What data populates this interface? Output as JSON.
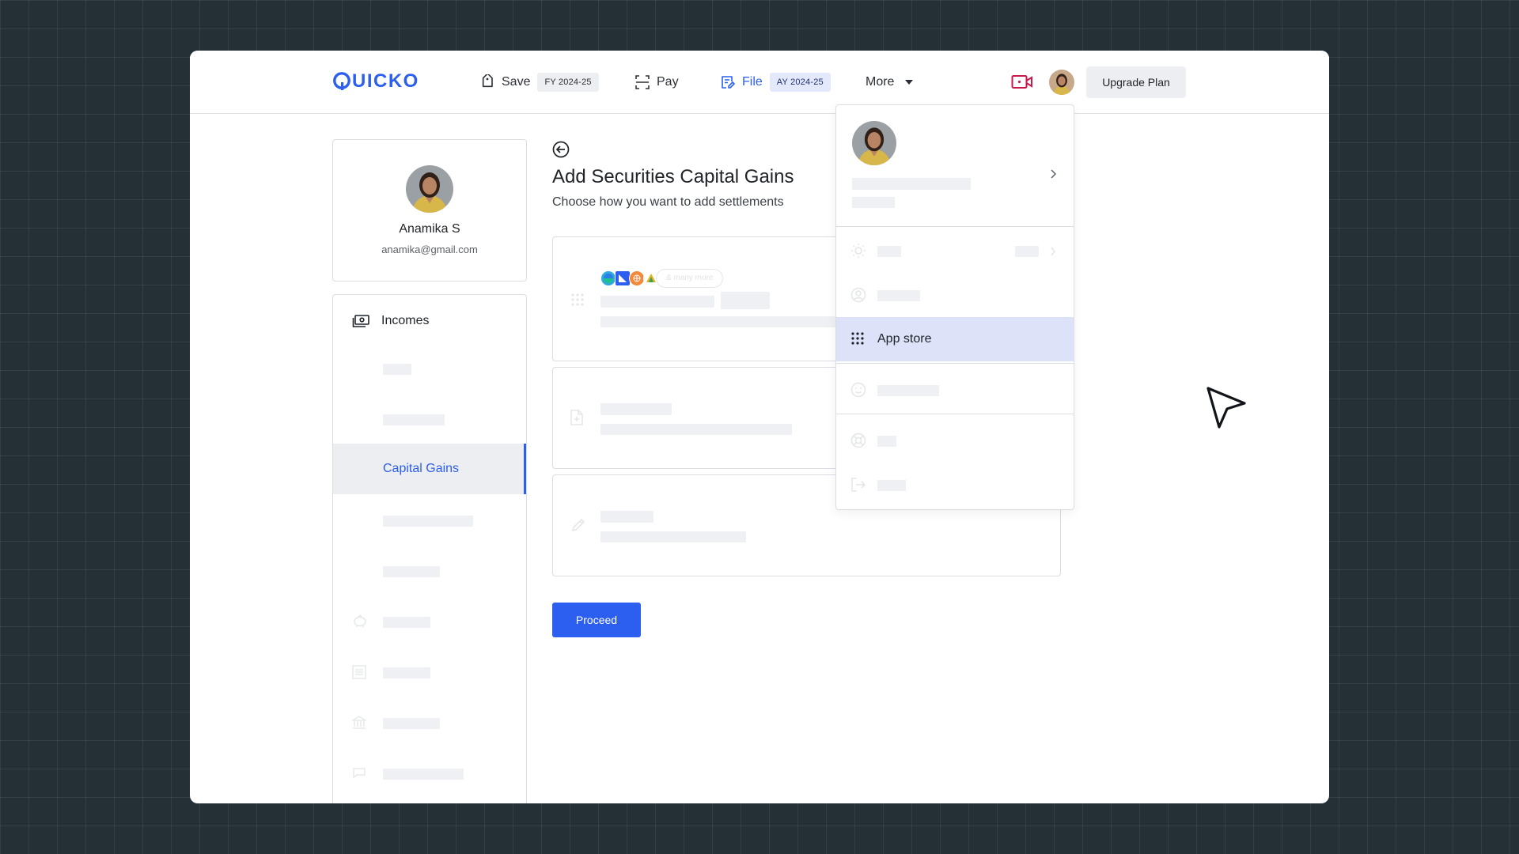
{
  "brand": {
    "name": "UICKO",
    "color": "#2c5ef0"
  },
  "nav": {
    "save": {
      "label": "Save",
      "badge": "FY 2024-25",
      "icon": "tag-icon"
    },
    "pay": {
      "label": "Pay",
      "icon": "scan-icon"
    },
    "file": {
      "label": "File",
      "badge": "AY 2024-25",
      "icon": "file-edit-icon"
    },
    "more": {
      "label": "More",
      "icon": "caret-down-icon"
    },
    "upgrade_label": "Upgrade Plan",
    "video_icon": "video-camera-icon"
  },
  "profile": {
    "name": "Anamika S",
    "email": "anamika@gmail.com"
  },
  "sidebar": {
    "header": "Incomes",
    "active_item": "Capital Gains"
  },
  "main": {
    "title": "Add Securities Capital Gains",
    "subtitle": "Choose how you want to add settlements",
    "broker_pill": "& many more",
    "proceed_label": "Proceed"
  },
  "dropdown": {
    "active_item": "App store",
    "active_icon": "grid-dots-icon"
  },
  "colors": {
    "accent": "#2c5ef0",
    "active_bg": "#dde2f8",
    "sidebar_active_bg": "#eceef2",
    "video_icon": "#c8174a",
    "backdrop": "#252f36"
  }
}
